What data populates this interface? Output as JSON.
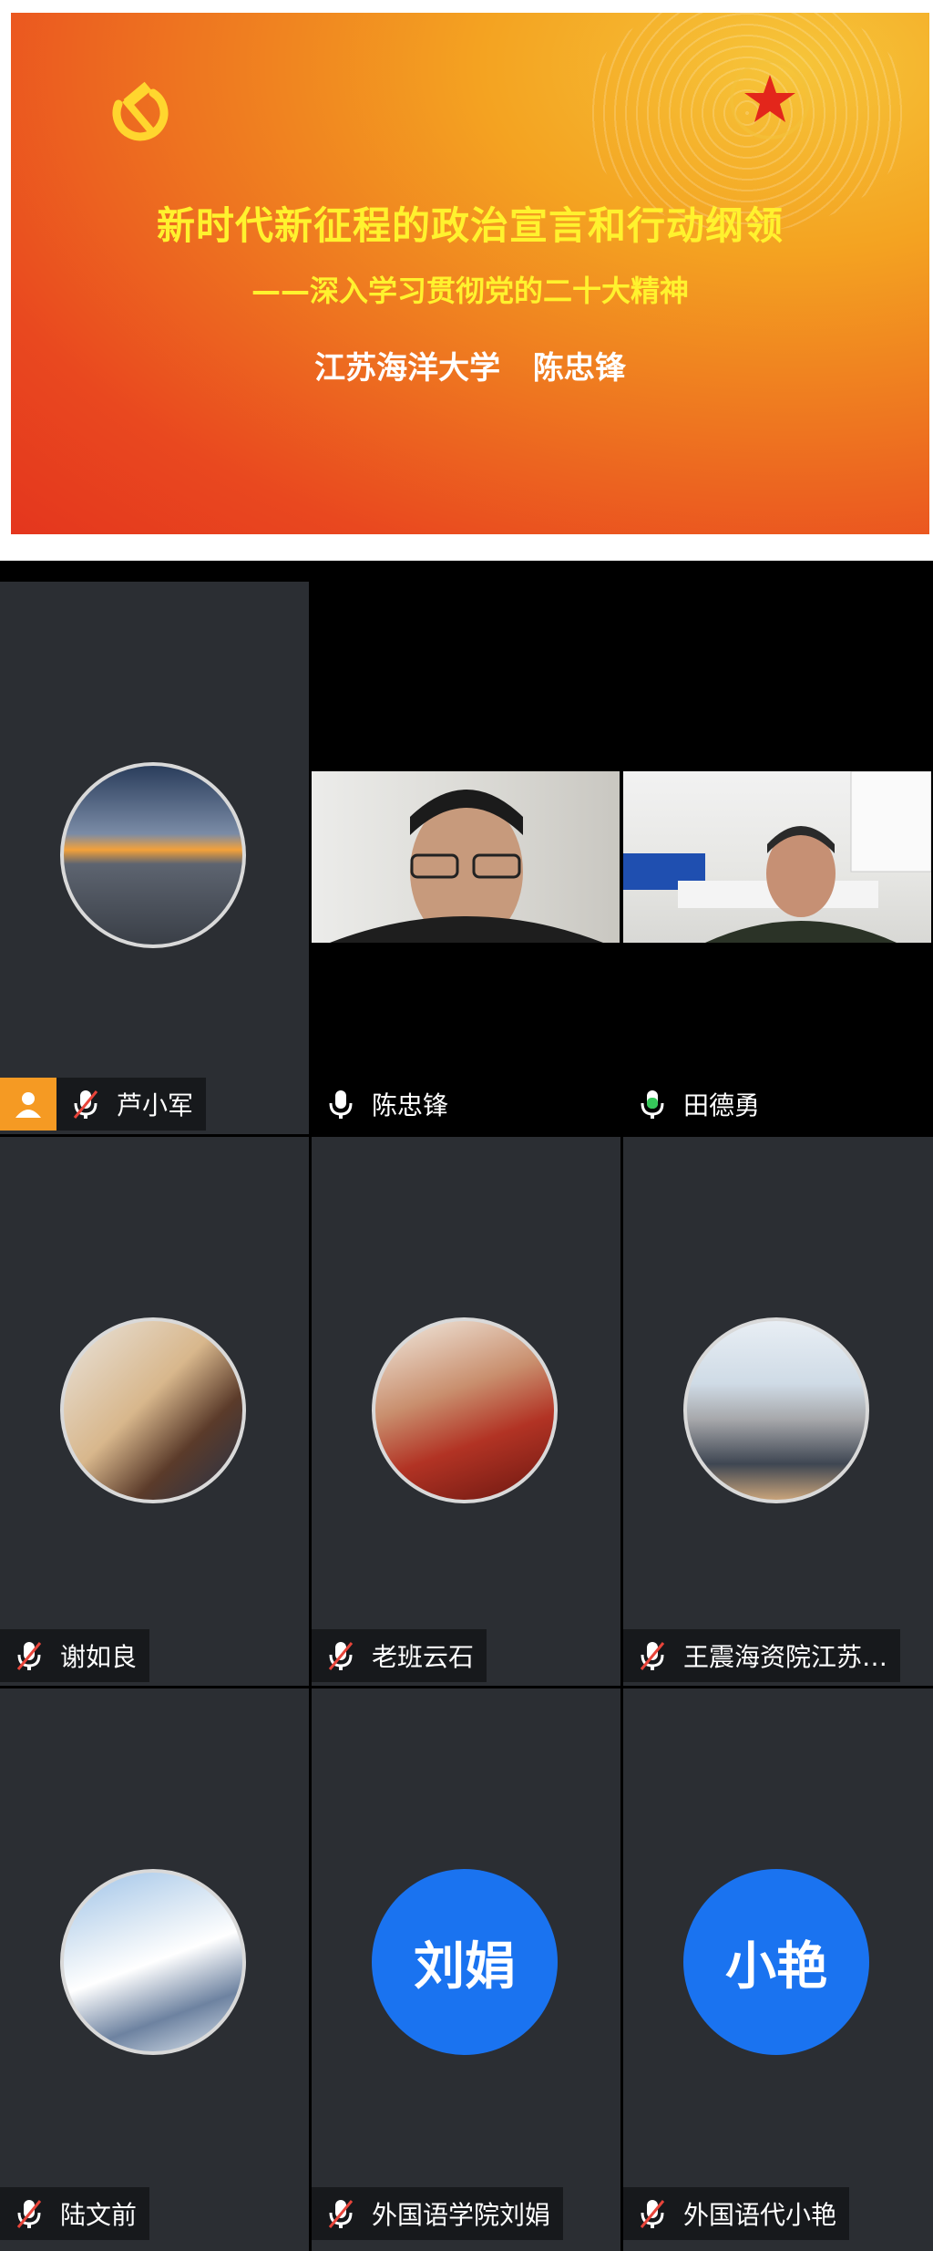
{
  "slide": {
    "title": "新时代新征程的政治宣言和行动纲领",
    "subtitle": "——深入学习贯彻党的二十大精神",
    "author": "江苏海洋大学  陈忠锋"
  },
  "participants": [
    {
      "name": "芦小军",
      "mic": "muted",
      "host": true,
      "avatar": "sunrise-clouds"
    },
    {
      "name": "陈忠锋",
      "mic": "on",
      "video": true
    },
    {
      "name": "田德勇",
      "mic": "speaking",
      "video": true
    },
    {
      "name": "谢如良",
      "mic": "muted",
      "avatar": "child-with-cake"
    },
    {
      "name": "老班云石",
      "mic": "muted",
      "avatar": "woman-red-dress"
    },
    {
      "name": "王震海资院江苏…",
      "mic": "muted",
      "avatar": "cartoon-old-man"
    },
    {
      "name": "陆文前",
      "mic": "muted",
      "avatar": "snowy-mountain"
    },
    {
      "name": "外国语学院刘娟",
      "mic": "muted",
      "avatar_text": "刘娟"
    },
    {
      "name": "外国语代小艳",
      "mic": "muted",
      "avatar_text": "小艳"
    }
  ],
  "colors": {
    "avatar_blue": "#1a73f0",
    "speaking_green": "#35c759",
    "muted_red": "#e8443a",
    "host_orange": "#f59a23"
  }
}
